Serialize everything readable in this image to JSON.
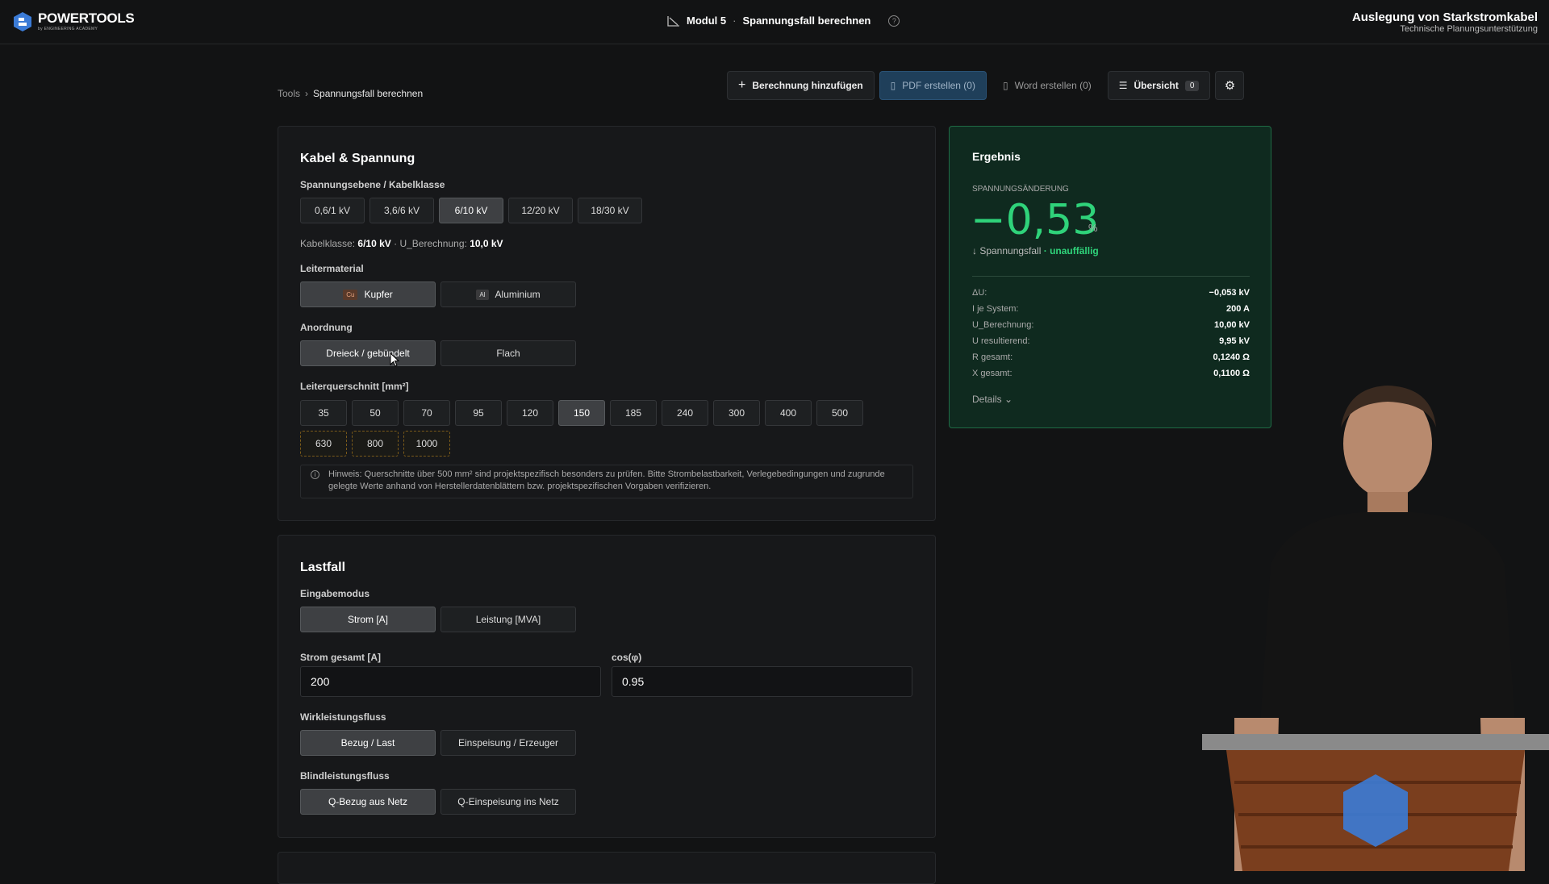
{
  "header": {
    "logo_title": "POWERTOOLS",
    "logo_sub": "by ENGINEERING ACADEMY",
    "modul": "Modul 5",
    "modul_title": "Spannungsfall berechnen",
    "course_title": "Auslegung von Starkstromkabel",
    "course_sub": "Technische Planungsunterstützung"
  },
  "breadcrumb": {
    "root": "Tools",
    "current": "Spannungsfall berechnen"
  },
  "toolbar": {
    "add": "Berechnung hinzufügen",
    "pdf": "PDF erstellen (0)",
    "word": "Word erstellen (0)",
    "overview": "Übersicht",
    "overview_count": "0"
  },
  "kabel": {
    "title": "Kabel & Spannung",
    "spannung_label": "Spannungsebene / Kabelklasse",
    "spannung_options": [
      "0,6/1 kV",
      "3,6/6 kV",
      "6/10 kV",
      "12/20 kV",
      "18/30 kV"
    ],
    "spannung_selected": "6/10 kV",
    "info_kabelklasse_label": "Kabelklasse:",
    "info_kabelklasse": "6/10 kV",
    "info_ub_label": "· U_Berechnung:",
    "info_ub": "10,0 kV",
    "leiter_label": "Leitermaterial",
    "leiter_options": [
      {
        "chip": "Cu",
        "label": "Kupfer"
      },
      {
        "chip": "Al",
        "label": "Aluminium"
      }
    ],
    "anordnung_label": "Anordnung",
    "anordnung_options": [
      "Dreieck / gebündelt",
      "Flach"
    ],
    "querschnitt_label": "Leiterquerschnitt [mm²]",
    "querschnitt_options": [
      "35",
      "50",
      "70",
      "95",
      "120",
      "150",
      "185",
      "240",
      "300",
      "400",
      "500"
    ],
    "querschnitt_selected": "150",
    "querschnitt_extra": [
      "630",
      "800",
      "1000"
    ],
    "hinweis": "Hinweis: Querschnitte über 500 mm² sind projektspezifisch besonders zu prüfen. Bitte Strombelastbarkeit, Verlegebedingungen und zugrunde gelegte Werte anhand von Herstellerdatenblättern bzw. projektspezifischen Vorgaben verifizieren."
  },
  "lastfall": {
    "title": "Lastfall",
    "modus_label": "Eingabemodus",
    "modus_options": [
      "Strom [A]",
      "Leistung [MVA]"
    ],
    "strom_label": "Strom gesamt [A]",
    "strom_value": "200",
    "cos_label": "cos(φ)",
    "cos_value": "0.95",
    "wirk_label": "Wirkleistungsfluss",
    "wirk_options": [
      "Bezug / Last",
      "Einspeisung / Erzeuger"
    ],
    "blind_label": "Blindleistungsfluss",
    "blind_options": [
      "Q-Bezug aus Netz",
      "Q-Einspeisung ins Netz"
    ]
  },
  "ergebnis": {
    "title": "Ergebnis",
    "caption": "SPANNUNGSÄNDERUNG",
    "value": "−0,53",
    "unit": "%",
    "direction": "↓ Spannungsfall",
    "status": "· unauffällig",
    "rows": [
      {
        "k": "ΔU:",
        "v": "−0,053 kV"
      },
      {
        "k": "I je System:",
        "v": "200 A"
      },
      {
        "k": "U_Berechnung:",
        "v": "10,00 kV"
      },
      {
        "k": "U resultierend:",
        "v": "9,95 kV"
      },
      {
        "k": "R gesamt:",
        "v": "0,1240 Ω"
      },
      {
        "k": "X gesamt:",
        "v": "0,1100 Ω"
      }
    ],
    "details": "Details"
  },
  "colors": {
    "accent_green": "#2fd37a",
    "result_bg": "#0f2a1f",
    "pdf_btn": "#1f3f5a"
  }
}
